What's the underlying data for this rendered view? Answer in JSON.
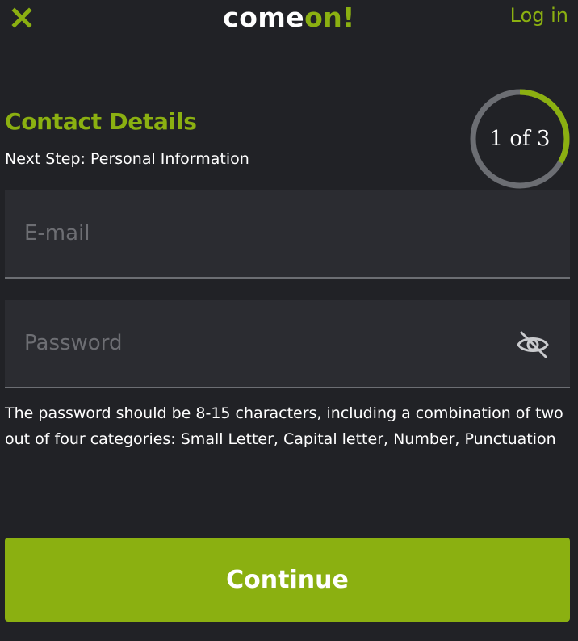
{
  "header": {
    "logo_part1": "come",
    "logo_part2": "on!",
    "login_label": "Log in",
    "close_icon": "close-icon"
  },
  "step": {
    "title": "Contact Details",
    "next_step": "Next Step: Personal Information",
    "progress_label": "1 of 3",
    "current": 1,
    "total": 3
  },
  "form": {
    "email_placeholder": "E-mail",
    "email_value": "",
    "password_placeholder": "Password",
    "password_value": "",
    "password_toggle_icon": "eye-off-icon",
    "password_hint": "The password should be 8-15 characters, including a combination of two out of four categories: Small Letter, Capital letter, Number, Punctuation"
  },
  "actions": {
    "continue_label": "Continue"
  },
  "colors": {
    "background": "#212226",
    "accent": "#8bb011",
    "field_bg": "#2b2c31",
    "ring_track": "#6c6e73"
  }
}
